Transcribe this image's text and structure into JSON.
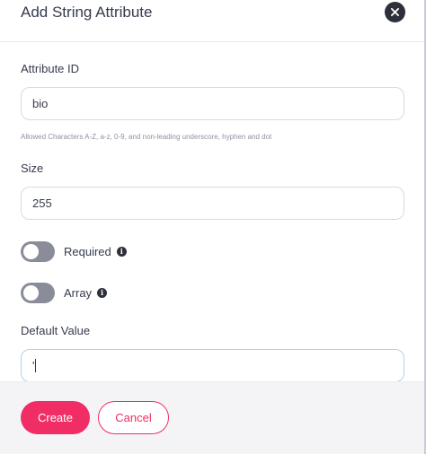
{
  "modal": {
    "title": "Add String Attribute",
    "close_icon": "close-icon"
  },
  "fields": {
    "attribute_id": {
      "label": "Attribute ID",
      "value": "bio",
      "hint": "Allowed Characters A-Z, a-z, 0-9, and non-leading underscore, hyphen and dot"
    },
    "size": {
      "label": "Size",
      "value": "255"
    },
    "required": {
      "label": "Required",
      "checked": false,
      "icon": "info-icon"
    },
    "array": {
      "label": "Array",
      "checked": false,
      "icon": "info-icon"
    },
    "default_value": {
      "label": "Default Value",
      "value": "'"
    }
  },
  "footer": {
    "create_label": "Create",
    "cancel_label": "Cancel"
  },
  "colors": {
    "accent": "#f02e65",
    "toggle_off": "#8a8d99",
    "focus_border": "#a9d4f2"
  }
}
